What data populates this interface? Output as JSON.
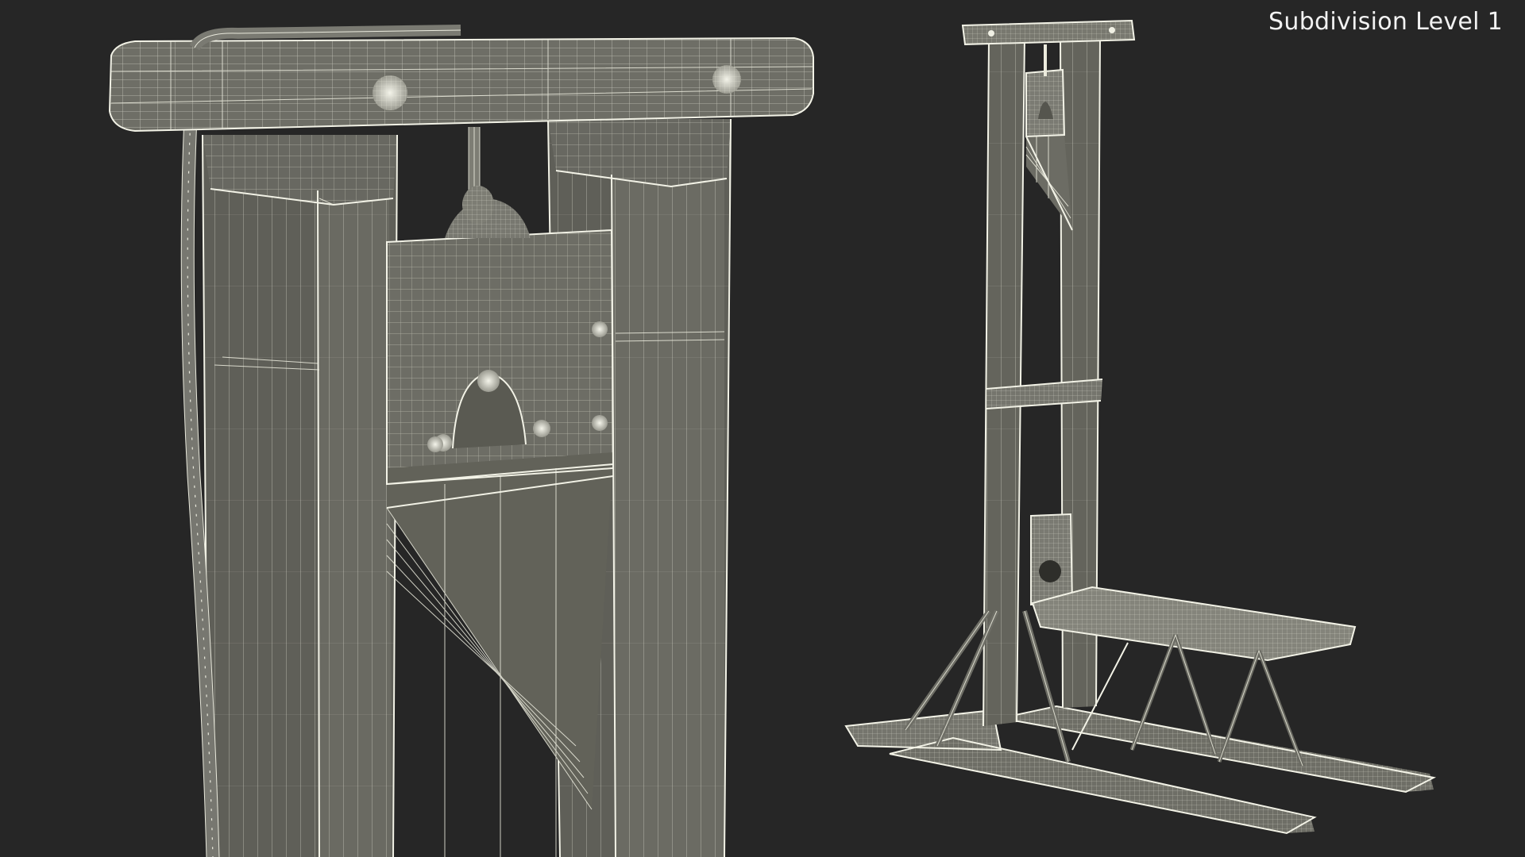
{
  "caption": {
    "text": "Subdivision Level 1"
  },
  "colors": {
    "background": "#262626",
    "surface": "#5d5d56",
    "surface_light": "#6b6b63",
    "wireframe": "#ededdf",
    "caption_text": "#f2f2f2"
  },
  "scene": {
    "subject": "guillotine-wireframe-model",
    "views": [
      "close-up-view",
      "full-view"
    ]
  }
}
